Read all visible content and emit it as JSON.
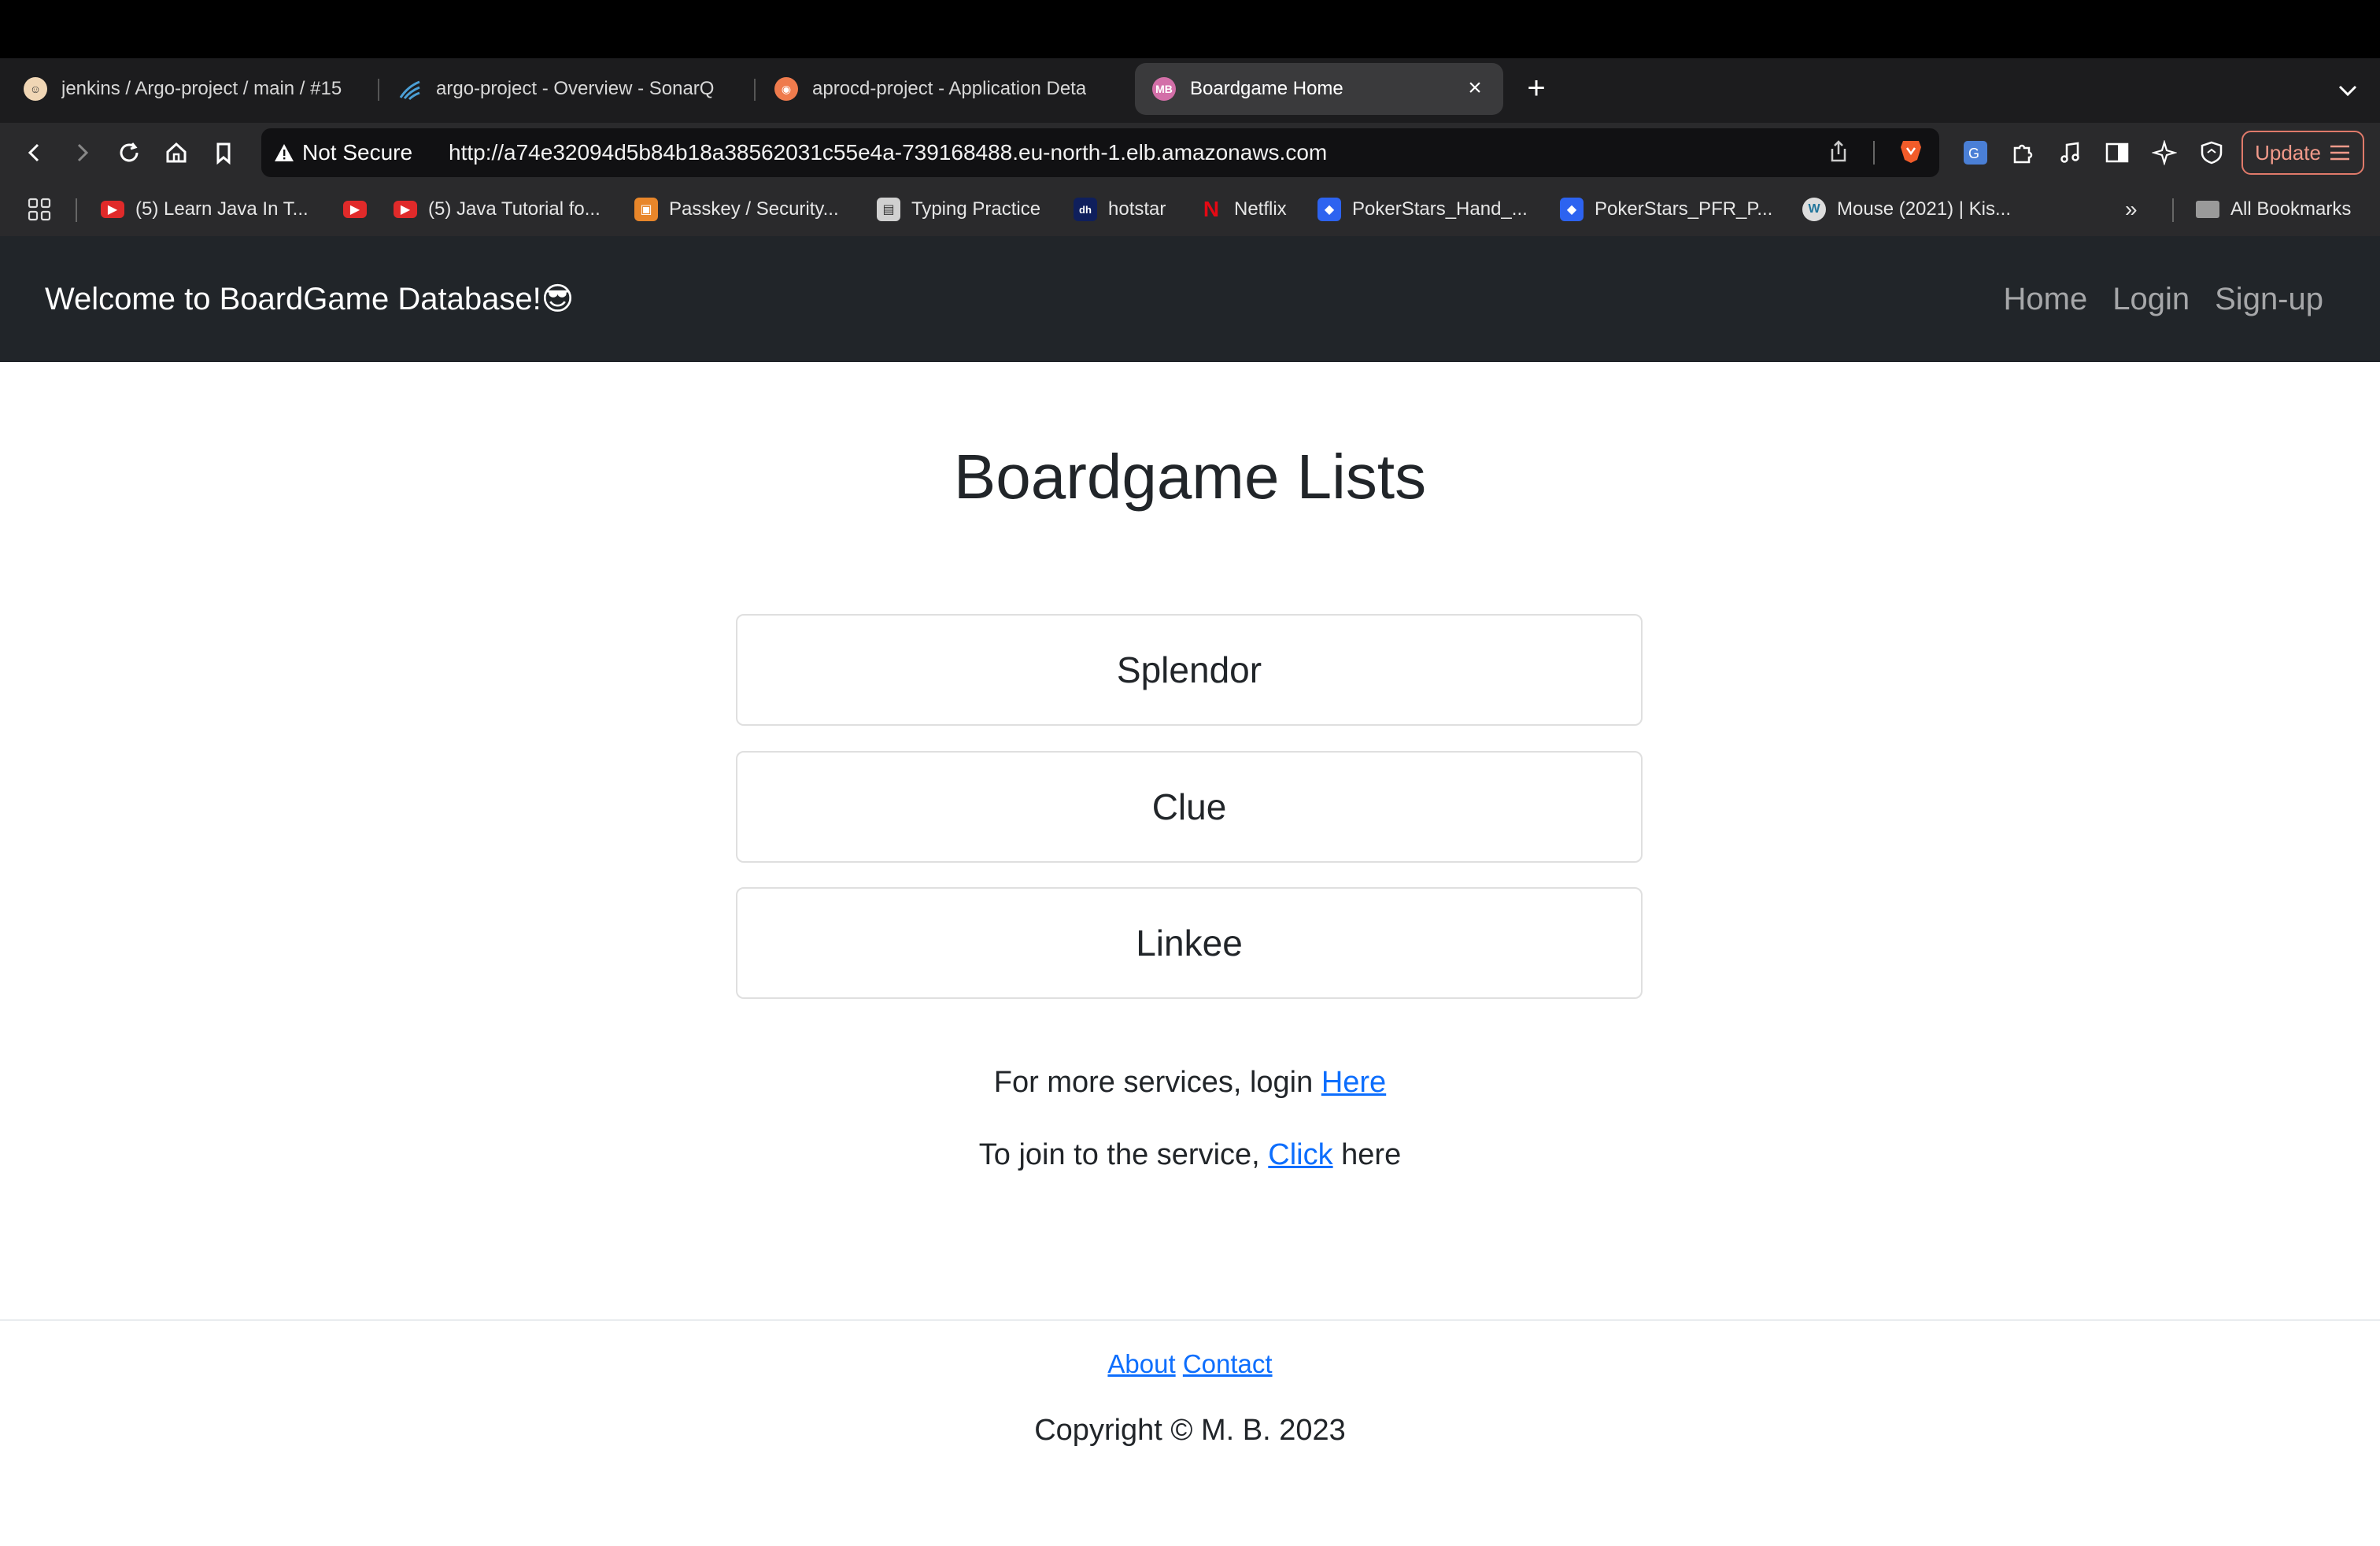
{
  "browser": {
    "tabs": [
      {
        "title": "jenkins / Argo-project / main / #15",
        "icon": "jenkins-icon"
      },
      {
        "title": "argo-project - Overview - SonarQ",
        "icon": "sonarqube-icon"
      },
      {
        "title": "aprocd-project - Application Deta",
        "icon": "argo-icon"
      },
      {
        "title": "Boardgame Home",
        "icon": "mb-icon",
        "active": true
      }
    ],
    "tab_favicon_text": "MB",
    "security_label": "Not Secure",
    "url": "http://a74e32094d5b84b18a38562031c55e4a-739168488.eu-north-1.elb.amazonaws.com",
    "update_label": "Update",
    "bookmarks": [
      {
        "label": "(5) Learn Java In T...",
        "icon": "youtube-icon"
      },
      {
        "label": "",
        "icon": "youtube-icon"
      },
      {
        "label": "(5) Java Tutorial fo...",
        "icon": "youtube-icon"
      },
      {
        "label": "Passkey / Security...",
        "icon": "box-icon"
      },
      {
        "label": "Typing Practice",
        "icon": "keyboard-icon"
      },
      {
        "label": "hotstar",
        "icon": "hotstar-icon"
      },
      {
        "label": "Netflix",
        "icon": "netflix-icon"
      },
      {
        "label": "PokerStars_Hand_...",
        "icon": "dropbox-icon"
      },
      {
        "label": "PokerStars_PFR_P...",
        "icon": "dropbox-icon"
      },
      {
        "label": "Mouse (2021) | Kis...",
        "icon": "wordpress-icon"
      }
    ],
    "all_bookmarks_label": "All Bookmarks"
  },
  "site": {
    "brand": "Welcome to BoardGame Database!😎",
    "nav": {
      "home": "Home",
      "login": "Login",
      "signup": "Sign-up"
    },
    "heading": "Boardgame Lists",
    "games": [
      "Splendor",
      "Clue",
      "Linkee"
    ],
    "login_text": "For more services, login ",
    "login_link": "Here",
    "join_text_before": "To join to the service, ",
    "join_link": "Click",
    "join_text_after": " here",
    "footer": {
      "about": "About",
      "contact": "Contact",
      "copyright": "Copyright © M. B. 2023"
    }
  },
  "colors": {
    "navbar": "#212529",
    "link": "#0d6efd",
    "tab_strip": "#1c1c1e",
    "toolbar": "#2a2a2c"
  }
}
